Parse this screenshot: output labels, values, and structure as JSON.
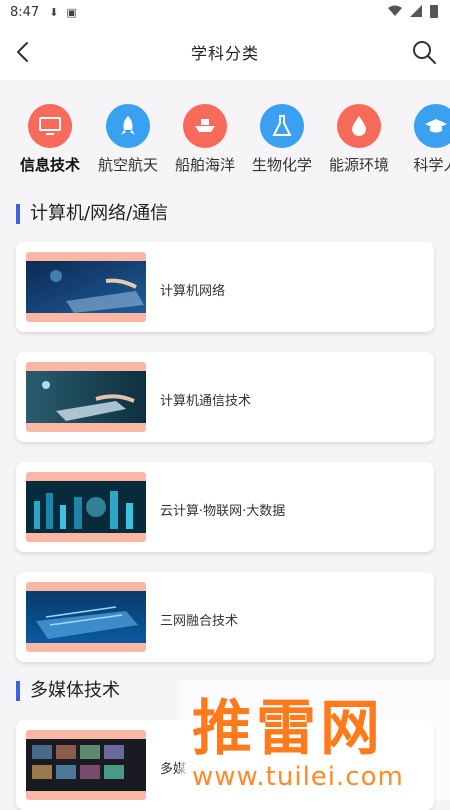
{
  "status_bar": {
    "time": "8:47"
  },
  "header": {
    "title": "学科分类"
  },
  "categories": [
    {
      "label": "信息技术",
      "color": "#f86b5a"
    },
    {
      "label": "航空航天",
      "color": "#3aa1f0"
    },
    {
      "label": "船舶海洋",
      "color": "#f86b5a"
    },
    {
      "label": "生物化学",
      "color": "#3aa1f0"
    },
    {
      "label": "能源环境",
      "color": "#f86b5a"
    },
    {
      "label": "科学人",
      "color": "#3aa1f0"
    }
  ],
  "sections": [
    {
      "title": "计算机/网络/通信",
      "items": [
        {
          "label": "计算机网络"
        },
        {
          "label": "计算机通信技术"
        },
        {
          "label": "云计算·物联网·大数据"
        },
        {
          "label": "三网融合技术"
        }
      ]
    },
    {
      "title": "多媒体技术",
      "items": [
        {
          "label": "多媒"
        }
      ]
    }
  ],
  "watermark": {
    "brand": "推雷网",
    "url": "www.tuilei.com"
  },
  "colors": {
    "accent": "#3b63d8",
    "thumb_bg": "#f9b7a4"
  }
}
